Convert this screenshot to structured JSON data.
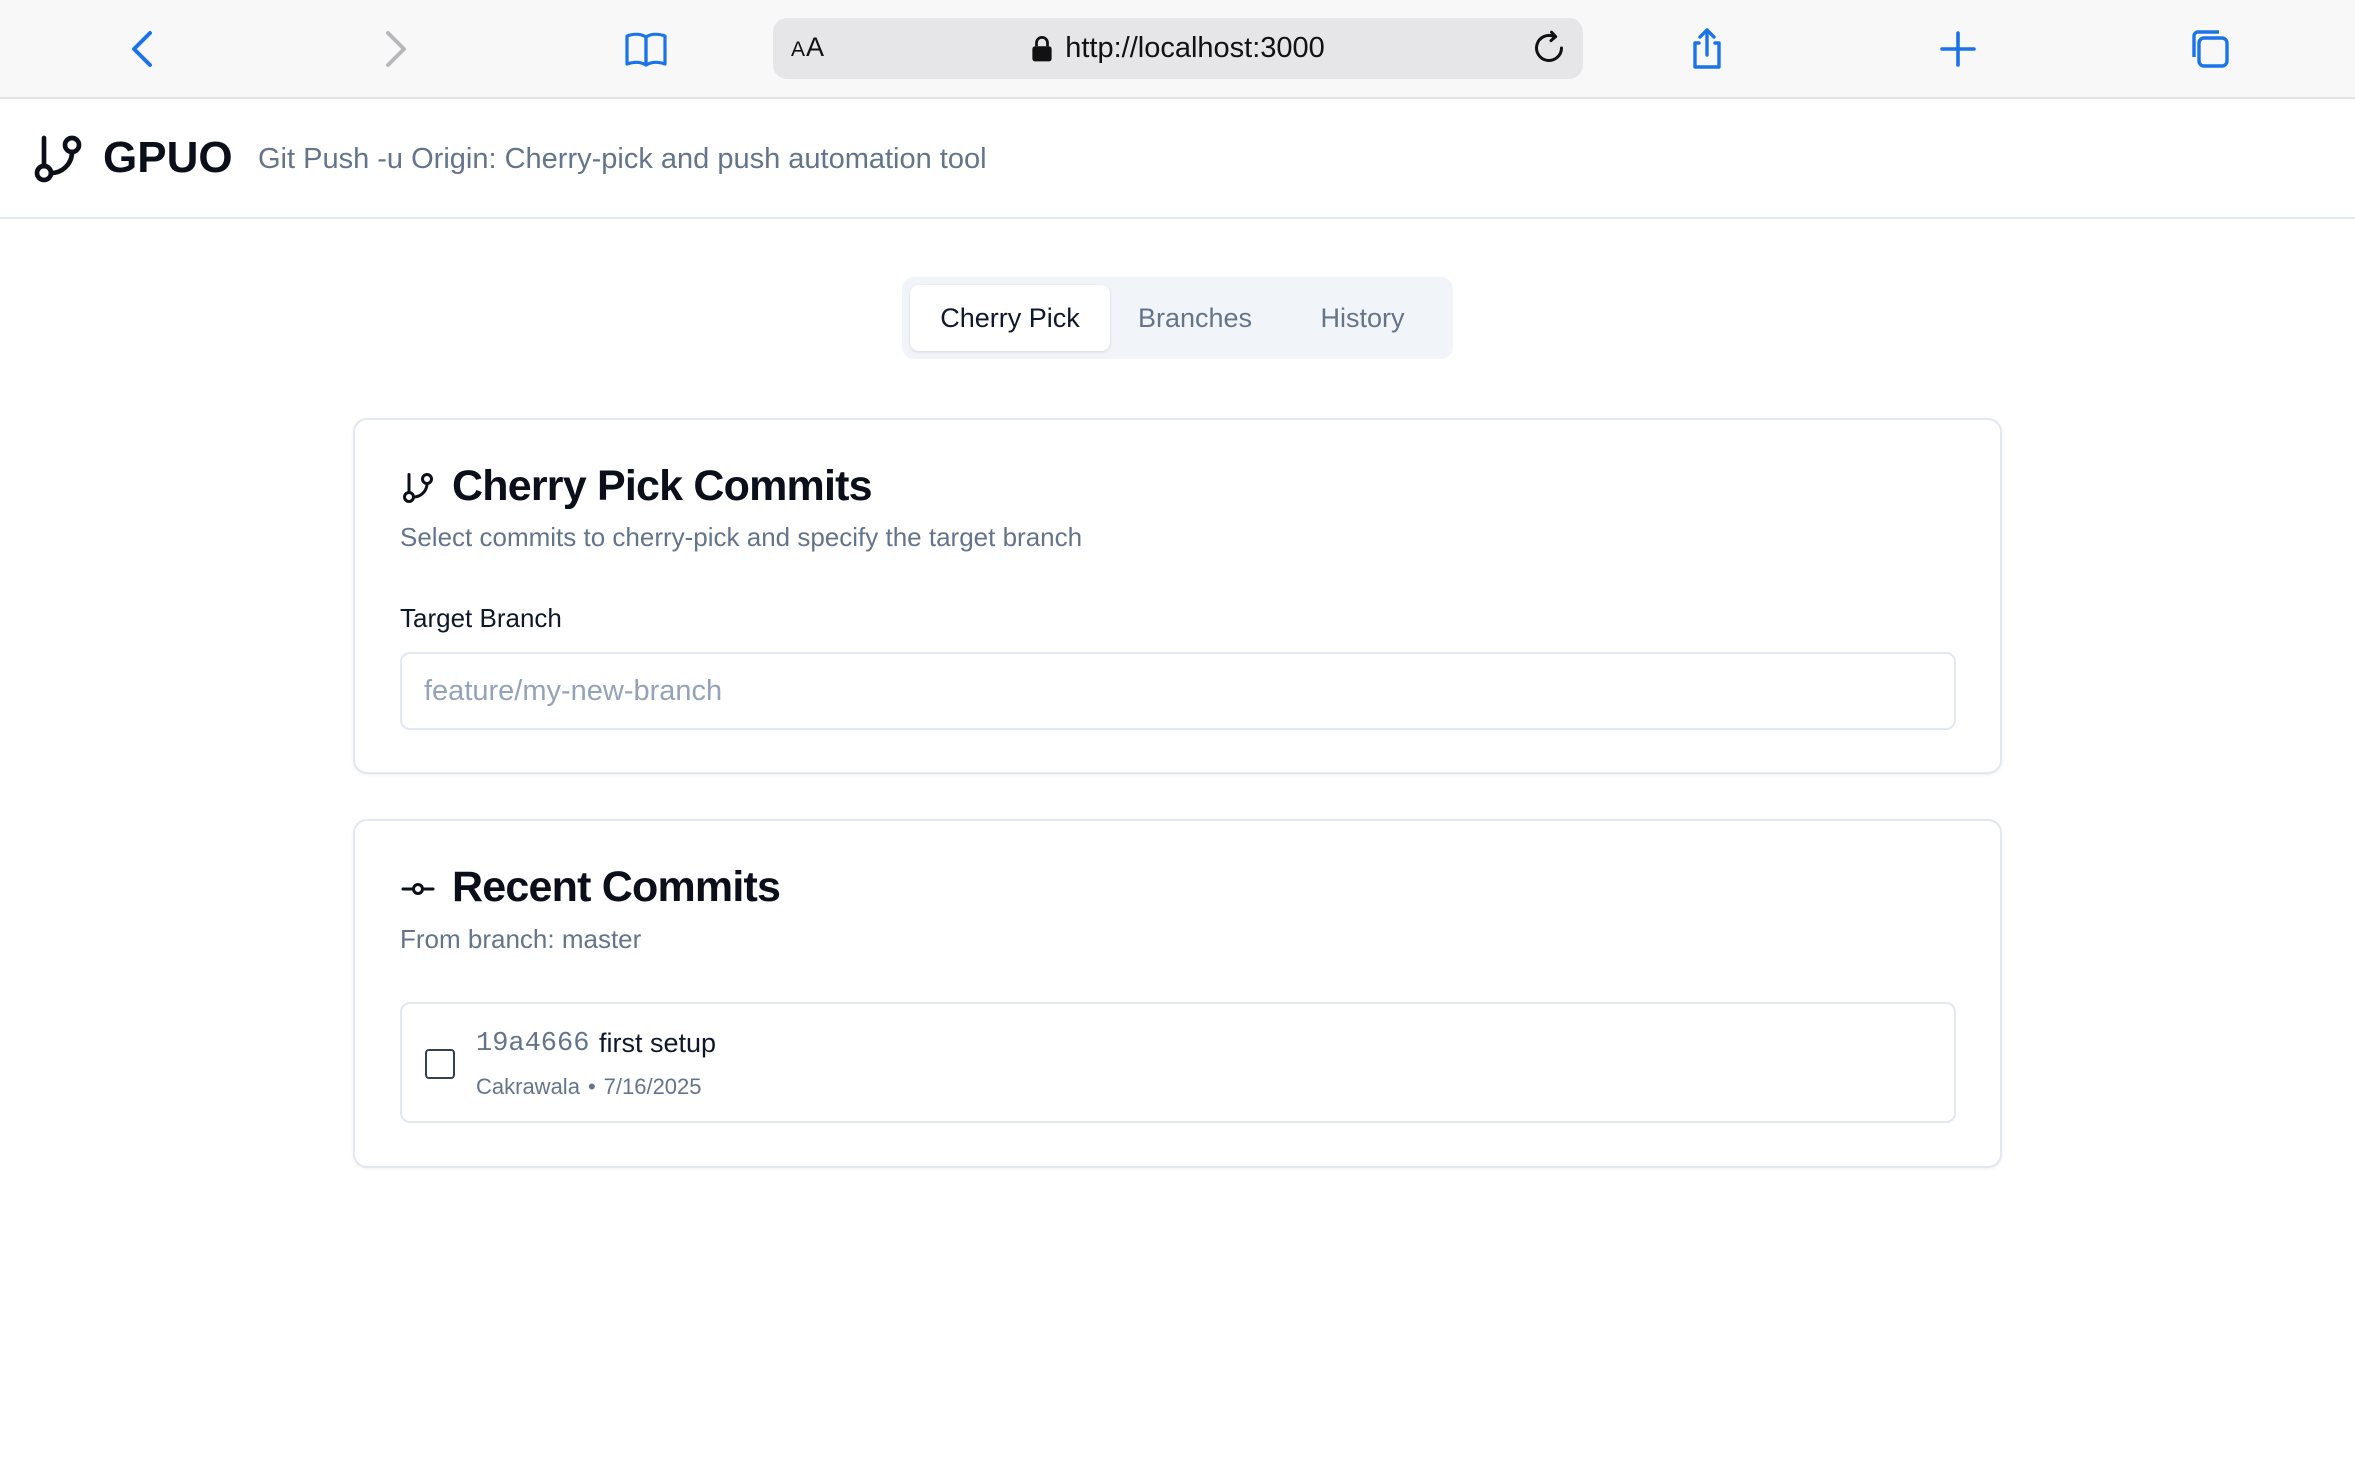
{
  "browser": {
    "aa_label_big": "A",
    "aa_label_small": "A",
    "url": "http://localhost:3000"
  },
  "header": {
    "title": "GPUO",
    "subtitle": "Git Push -u Origin: Cherry-pick and push automation tool"
  },
  "tabs": [
    {
      "label": "Cherry Pick",
      "active": true
    },
    {
      "label": "Branches",
      "active": false
    },
    {
      "label": "History",
      "active": false
    }
  ],
  "cherry_pick": {
    "title": "Cherry Pick Commits",
    "description": "Select commits to cherry-pick and specify the target branch",
    "target_label": "Target Branch",
    "target_placeholder": "feature/my-new-branch",
    "target_value": ""
  },
  "recent": {
    "title": "Recent Commits",
    "from_branch": "From branch: master",
    "commits": [
      {
        "hash": "19a4666",
        "message": "first setup",
        "author": "Cakrawala",
        "separator": "•",
        "date": "7/16/2025",
        "checked": false
      }
    ]
  },
  "colors": {
    "accent": "#1a73e8",
    "muted_text": "#64748b",
    "border": "#e2e8f0",
    "tab_bg": "#f1f5f9"
  }
}
